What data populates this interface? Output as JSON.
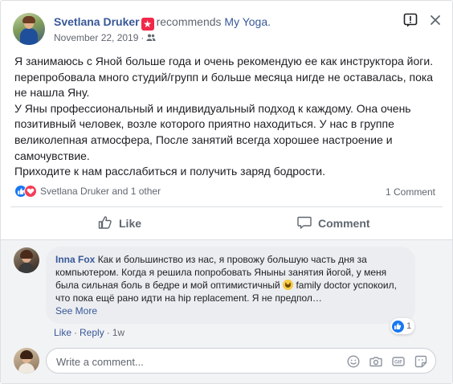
{
  "post": {
    "author": "Svetlana Druker",
    "action": "recommends",
    "page": "My Yoga.",
    "date": "November 22, 2019",
    "separator": "·",
    "body": [
      "Я занимаюсь с Яной больше года и очень рекомендую ее как инструктора йоги. перепробовала много студий/групп и больше месяца нигде не оставалась, пока не нашла Яну.",
      "У Яны профессиональный и индивидуальный подход к каждому. Она очень позитивный человек, возле которого приятно находиться. У нас в группе великолепная атмосфера, После занятий всегда хорошее настроение и самочувствие.",
      "Приходите к нам расслабиться и получить заряд бодрости."
    ],
    "reactions_text": "Svetlana Druker and 1 other",
    "comment_count": "1 Comment"
  },
  "actions": {
    "like": "Like",
    "comment": "Comment"
  },
  "comment": {
    "author": "Inna Fox",
    "text_before_emoji": "Как и большинство из нас, я провожу большую часть дня за компьютером. Когда я решила попробовать Яныны занятия йогой, у меня была сильная боль в бедре и мой оптимистичный",
    "text_after_emoji": "family doctor успокоил, что пока ещё рано идти на hip replacement. Я не предпол…",
    "see_more": "See More",
    "reaction_count": "1",
    "like": "Like",
    "reply": "Reply",
    "separator": "·",
    "time": "1w"
  },
  "composer": {
    "placeholder": "Write a comment..."
  },
  "colors": {
    "link": "#385898",
    "like_blue": "#1877f2",
    "love_red": "#f33e58",
    "secondary_text": "#606770"
  },
  "icons": {
    "report": "report-icon",
    "close": "close-icon",
    "friends": "friends-audience-icon",
    "recommend_badge": "recommend-badge-icon",
    "like_reaction": "like-reaction-icon",
    "love_reaction": "love-reaction-icon",
    "like_button": "thumbs-up-icon",
    "comment_button": "speech-bubble-icon",
    "emoji": "smile-emoji-icon",
    "camera": "camera-icon",
    "gif": "gif-icon",
    "sticker": "sticker-icon"
  }
}
